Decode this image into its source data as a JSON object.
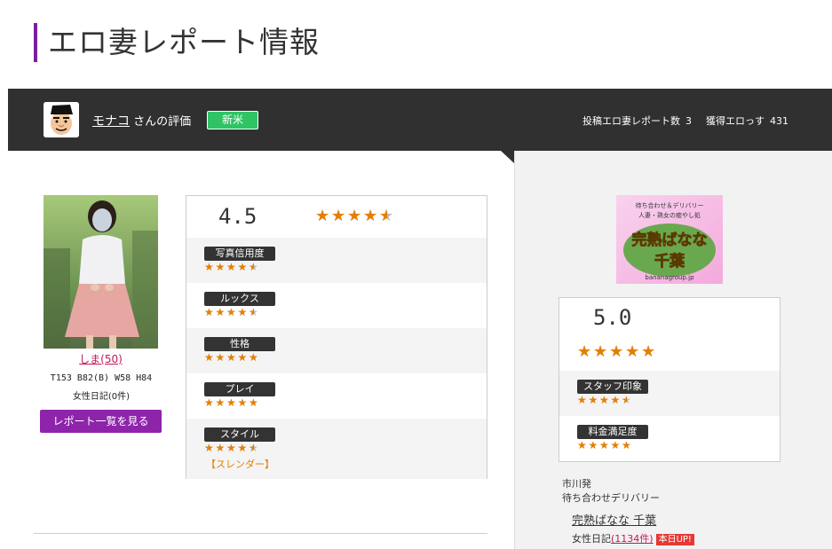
{
  "page": {
    "title": "エロ妻レポート情報"
  },
  "reviewer": {
    "name": "モナコ",
    "suffix": "さんの評価",
    "rank": "新米",
    "posts_label": "投稿エロ妻レポート数",
    "posts_value": "3",
    "points_label": "獲得エロっす",
    "points_value": "431"
  },
  "girl": {
    "name": "しま(50)",
    "size": "T153 B82(B) W58 H84",
    "diary": "女性日記(0件)",
    "report_list_label": "レポート一覧を見る"
  },
  "girl_score": {
    "total": "4.5",
    "total_rating": 4.5,
    "criteria": [
      {
        "label": "写真信用度",
        "rating": 4.5
      },
      {
        "label": "ルックス",
        "rating": 4.5
      },
      {
        "label": "性格",
        "rating": 5
      },
      {
        "label": "プレイ",
        "rating": 5
      },
      {
        "label": "スタイル",
        "rating": 4.5,
        "extra": "【スレンダー】"
      }
    ]
  },
  "shop": {
    "banner": {
      "line1": "待ち合わせ＆デリバリー",
      "line2": "人妻・熟女の癒やし処",
      "title1": "完熟ばなな",
      "title2": "千葉",
      "url": "bananagroup.jp"
    },
    "total": "5.0",
    "total_rating": 5,
    "criteria": [
      {
        "label": "スタッフ印象",
        "rating": 4.5
      },
      {
        "label": "料金満足度",
        "rating": 5
      }
    ],
    "area": "市川発",
    "type": "待ち合わせデリバリー",
    "name": "完熟ばなな 千葉",
    "diary_label": "女性日記",
    "diary_count": "(1134件)",
    "today_badge": "本日UP!"
  },
  "colors": {
    "accent": "#7b1fa2",
    "button": "#8e24aa",
    "star": "#e67e00",
    "rank_badge": "#2fc364",
    "bar": "#303030"
  }
}
